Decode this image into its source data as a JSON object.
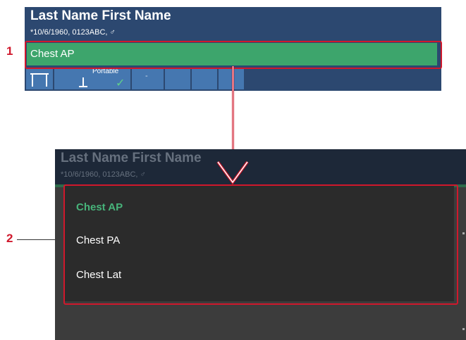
{
  "callouts": [
    "1",
    "2"
  ],
  "panel1": {
    "patient_name": "Last Name First Name",
    "patient_meta": "*10/6/1960, 0123ABC, ♂",
    "selected_procedure": "Chest AP",
    "tiles": {
      "portable_label": "Portable",
      "checkmark": "✓",
      "dash": "-"
    }
  },
  "panel2": {
    "patient_name": "Last Name First Name",
    "patient_meta": "*10/6/1960, 0123ABC, ♂",
    "dropdown_options": [
      "Chest AP",
      "Chest PA",
      "Chest Lat"
    ],
    "selected_index": 0
  },
  "colors": {
    "header_blue": "#2c4870",
    "selected_green": "#3da56c",
    "callout_red": "#d0182c",
    "dropdown_bg": "#2b2b2b"
  }
}
